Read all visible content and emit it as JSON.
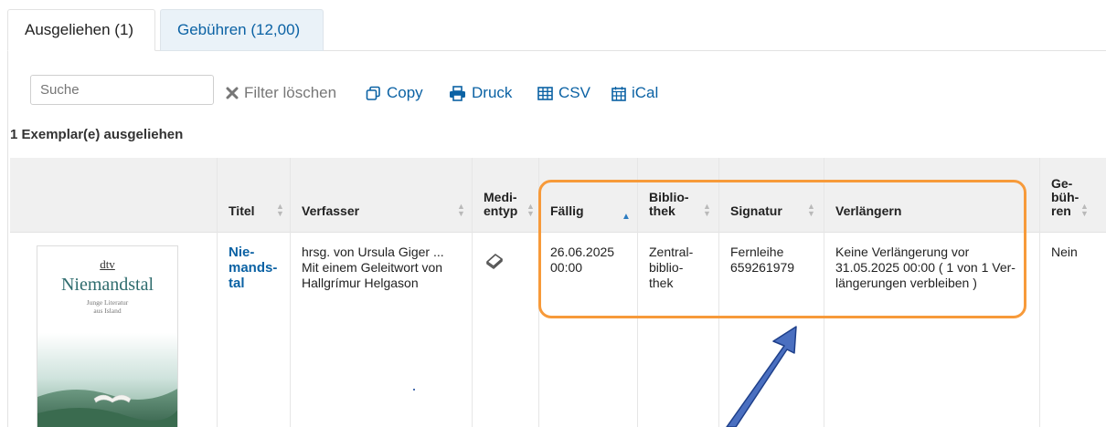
{
  "tabs": {
    "active_label": "Ausgeliehen (1)",
    "inactive_label": "Gebühren (12,00)"
  },
  "search": {
    "placeholder": "Suche"
  },
  "toolbar": {
    "clear_filter": "Filter löschen",
    "copy": "Copy",
    "print": "Druck",
    "csv": "CSV",
    "ical": "iCal"
  },
  "summary": {
    "count_text": "1 Exemplar(e) ausgeliehen"
  },
  "columns": {
    "title": "Titel",
    "author": "Verfasser",
    "media_type": [
      "Medi-",
      "entyp"
    ],
    "due": "Fällig",
    "library": [
      "Biblio-",
      "thek"
    ],
    "shelfmark": "Signatur",
    "renew": "Verlängern",
    "fees": [
      "Ge-",
      "büh-",
      "ren"
    ]
  },
  "row": {
    "cover": {
      "publisher": "dtv",
      "title": "Niemandstal",
      "subtitle": [
        "Junge Literatur",
        "aus Island"
      ]
    },
    "title": [
      "Nie-",
      "mands-",
      "tal"
    ],
    "author": [
      "hrsg. von Ursula Giger ...",
      "Mit einem Geleitwort von",
      "Hallgrímur Helgason"
    ],
    "due": [
      "26.06.2025",
      "00:00"
    ],
    "library": [
      "Zentral-",
      "biblio-",
      "thek"
    ],
    "shelfmark": [
      "Fernleihe",
      "659261979"
    ],
    "renew": [
      "Keine Verlängerung vor",
      "31.05.2025 00:00 ( 1 von 1 Ver-",
      "längerungen verbleiben )"
    ],
    "fees": "Nein"
  },
  "colors": {
    "link": "#0b62a4",
    "highlight": "#f79a3a",
    "arrow": "#4a6fc0"
  },
  "icons": {
    "clear_filter": "close-x-icon",
    "copy": "copy-icon",
    "print": "print-icon",
    "csv": "table-icon",
    "ical": "calendar-icon",
    "media_type": "book-icon"
  }
}
